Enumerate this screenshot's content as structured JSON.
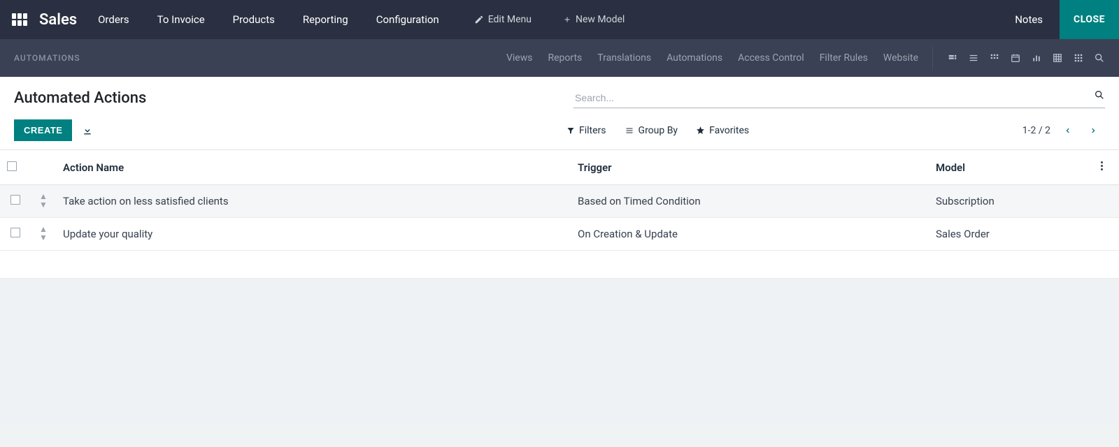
{
  "topbar": {
    "brand": "Sales",
    "menu": [
      "Orders",
      "To Invoice",
      "Products",
      "Reporting",
      "Configuration"
    ],
    "edit_menu_label": "Edit Menu",
    "new_model_label": "New Model",
    "notes_label": "Notes",
    "close_label": "CLOSE"
  },
  "subbar": {
    "breadcrumb": "AUTOMATIONS",
    "menu": [
      "Views",
      "Reports",
      "Translations",
      "Automations",
      "Access Control",
      "Filter Rules",
      "Website"
    ]
  },
  "controlpanel": {
    "title": "Automated Actions",
    "search_placeholder": "Search...",
    "create_label": "CREATE",
    "filters_label": "Filters",
    "groupby_label": "Group By",
    "favorites_label": "Favorites",
    "pager_text": "1-2 / 2"
  },
  "table": {
    "headers": {
      "action": "Action Name",
      "trigger": "Trigger",
      "model": "Model"
    },
    "rows": [
      {
        "action": "Take action on less satisfied clients",
        "trigger": "Based on Timed Condition",
        "model": "Subscription"
      },
      {
        "action": "Update your quality",
        "trigger": "On Creation & Update",
        "model": "Sales Order"
      }
    ]
  }
}
